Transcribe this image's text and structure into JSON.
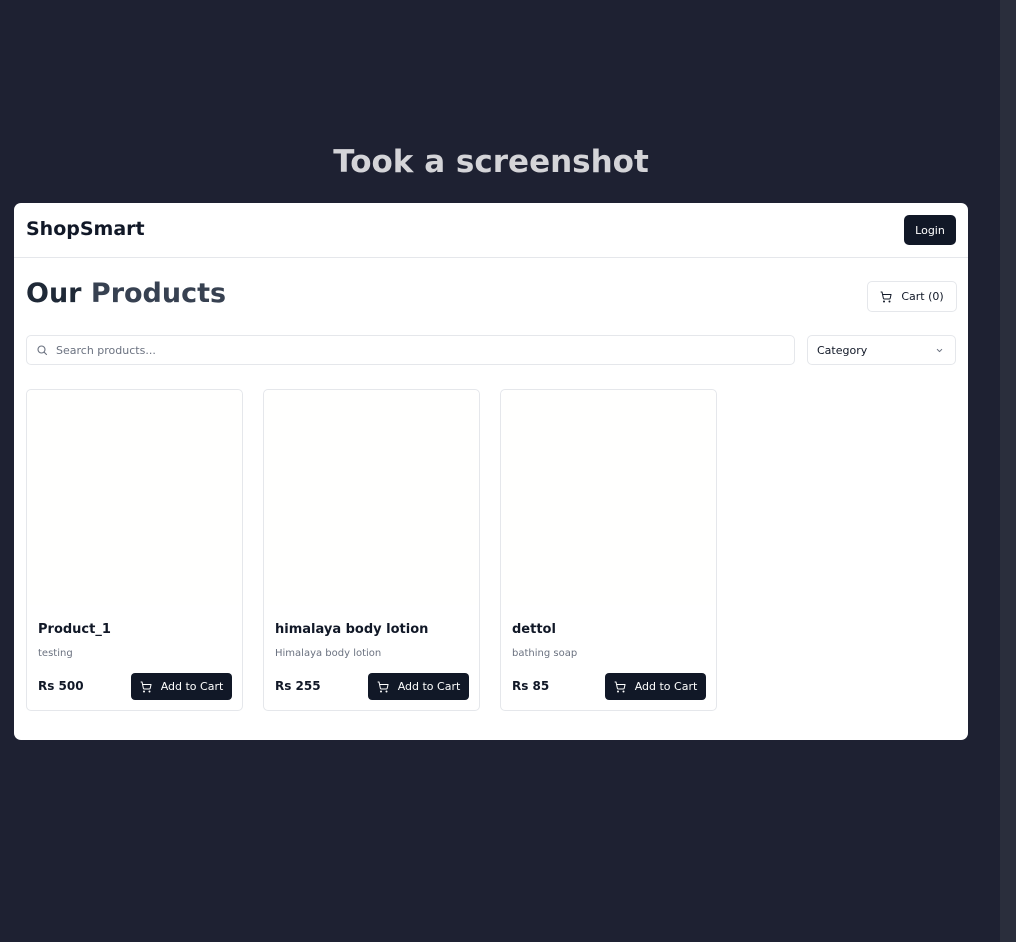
{
  "caption": "Took a screenshot",
  "header": {
    "brand": "ShopSmart",
    "login_label": "Login"
  },
  "main": {
    "title_part1": "Our",
    "title_part2": "Products",
    "cart_label": "Cart (0)",
    "search_placeholder": "Search products...",
    "category_label": "Category"
  },
  "products": [
    {
      "name": "Product_1",
      "description": "testing",
      "price": "Rs 500",
      "button": "Add to Cart"
    },
    {
      "name": "himalaya body lotion",
      "description": "Himalaya body lotion",
      "price": "Rs 255",
      "button": "Add to Cart"
    },
    {
      "name": "dettol",
      "description": "bathing soap",
      "price": "Rs 85",
      "button": "Add to Cart"
    }
  ],
  "icons": {
    "cart": "shopping-cart-icon",
    "search": "search-icon",
    "chevron": "chevron-down-icon"
  },
  "colors": {
    "background": "#1e2132",
    "primary": "#111827",
    "surface": "#ffffff"
  }
}
